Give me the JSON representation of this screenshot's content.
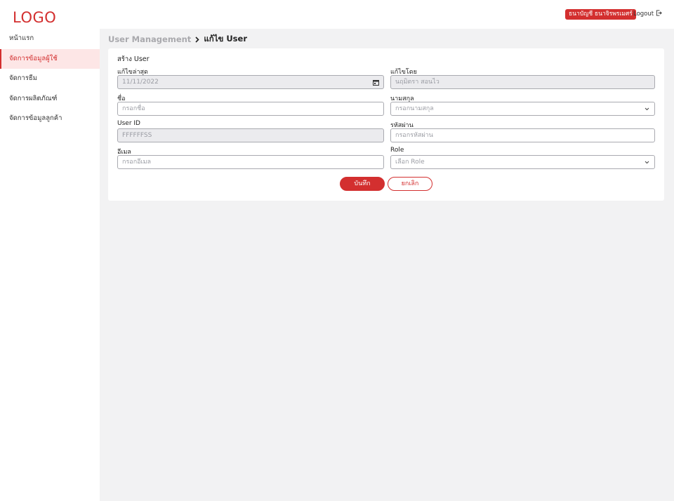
{
  "header": {
    "logo": "LOGO",
    "user_name": "ธนาบัญชี ธนาจิรพรเมศร์",
    "logout_label": "Logout"
  },
  "sidebar": {
    "items": [
      {
        "label": "หน้าแรก",
        "active": false
      },
      {
        "label": "จัดการข้อมูลผู้ใช้",
        "active": true
      },
      {
        "label": "จัดการธีม",
        "active": false
      },
      {
        "label": "จัดการผลิตภัณฑ์",
        "active": false
      },
      {
        "label": "จัดการข้อมูลลูกค้า",
        "active": false
      }
    ]
  },
  "breadcrumb": {
    "parent": "User Management",
    "current": "แก้ไข User"
  },
  "form": {
    "title": "สร้าง User",
    "fields": {
      "last_edited": {
        "label": "แก้ไขล่าสุด",
        "value": "11/11/2022"
      },
      "edited_by": {
        "label": "แก้ไขโดย",
        "value": "นฤมิตรา สอนไว"
      },
      "first_name": {
        "label": "ชื่อ",
        "placeholder": "กรอกชื่อ"
      },
      "last_name": {
        "label": "นามสกุล",
        "placeholder": "กรอกนามสกุล"
      },
      "user_id": {
        "label": "User ID",
        "value": "FFFFFFSS"
      },
      "password": {
        "label": "รหัสผ่าน",
        "placeholder": "กรอกรหัสผ่าน"
      },
      "email": {
        "label": "อีเมล",
        "placeholder": "กรอกอีเมล"
      },
      "role": {
        "label": "Role",
        "placeholder": "เลือก Role"
      }
    },
    "save_label": "บันทึก",
    "cancel_label": "ยกเลิก"
  },
  "colors": {
    "accent": "#d32f2f",
    "active_bg": "#fde6e6",
    "page_bg": "#f2f2f3",
    "disabled_bg": "#ebebee"
  },
  "icons": {
    "calendar": "calendar-icon",
    "chevron_down": "chevron-down-icon",
    "logout": "logout-icon",
    "breadcrumb_separator": "chevron-right-icon"
  }
}
